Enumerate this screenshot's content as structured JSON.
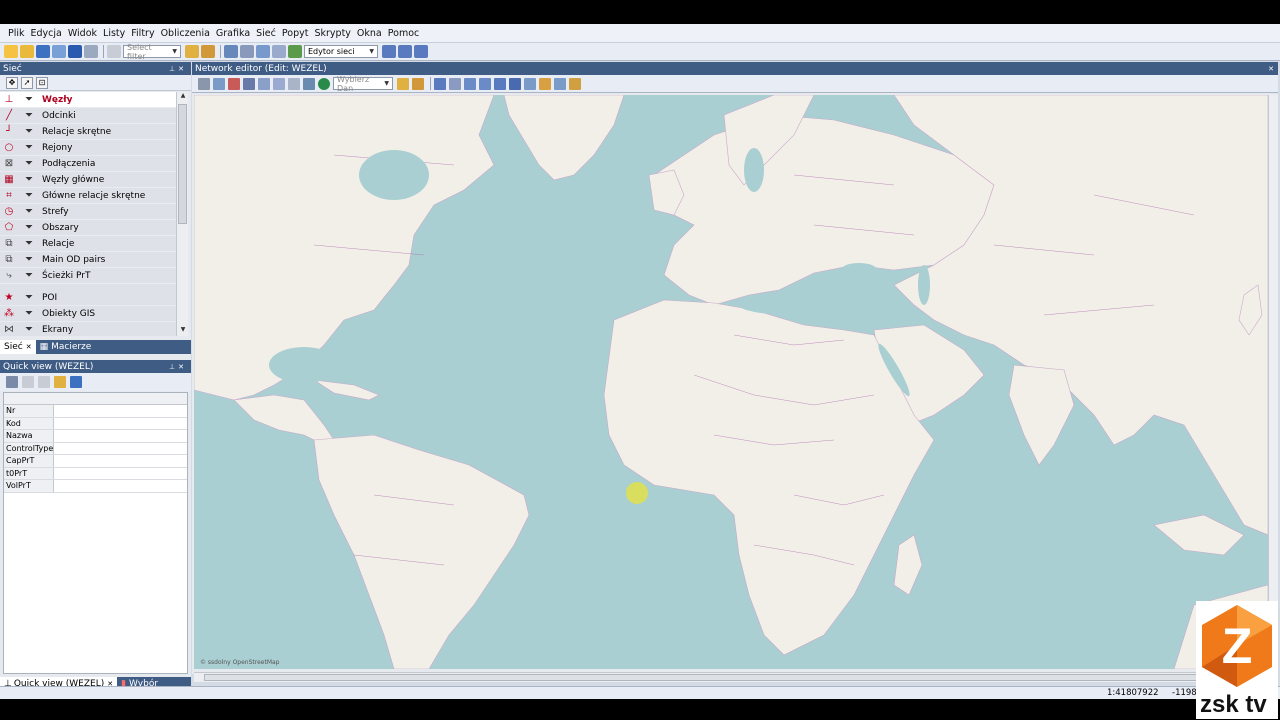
{
  "menu": [
    "Plik",
    "Edycja",
    "Widok",
    "Listy",
    "Filtry",
    "Obliczenia",
    "Grafika",
    "Sieć",
    "Popyt",
    "Skrypty",
    "Okna",
    "Pomoc"
  ],
  "toolbar": {
    "filter_placeholder": "Select filter",
    "mode_value": "Edytor sieci"
  },
  "siec_panel": {
    "title": "Sieć",
    "layers": [
      {
        "label": "Węzły",
        "icon": "node-icon",
        "active": true
      },
      {
        "label": "Odcinki",
        "icon": "link-icon"
      },
      {
        "label": "Relacje skrętne",
        "icon": "turn-icon"
      },
      {
        "label": "Rejony",
        "icon": "zone-icon"
      },
      {
        "label": "Podłączenia",
        "icon": "connector-icon"
      },
      {
        "label": "Węzły główne",
        "icon": "main-node-icon"
      },
      {
        "label": "Główne relacje skrętne",
        "icon": "main-turn-icon"
      },
      {
        "label": "Strefy",
        "icon": "territory-icon"
      },
      {
        "label": "Obszary",
        "icon": "area-icon"
      },
      {
        "label": "Relacje",
        "icon": "relation-icon"
      },
      {
        "label": "Main OD pairs",
        "icon": "od-pairs-icon"
      },
      {
        "label": "Ścieżki PrT",
        "icon": "path-icon"
      },
      {
        "label": "POI",
        "icon": "poi-star-icon"
      },
      {
        "label": "Obiekty GIS",
        "icon": "gis-icon"
      },
      {
        "label": "Ekrany",
        "icon": "screenline-icon"
      }
    ],
    "tabs": [
      "Sieć",
      "Macierze"
    ]
  },
  "quick_view": {
    "title": "Quick view (WEZEL)",
    "fields": [
      "Nr",
      "Kod",
      "Nazwa",
      "ControlType",
      "CapPrT",
      "t0PrT",
      "VolPrT"
    ],
    "tabs": [
      "Quick view (WEZEL)",
      "Wybór"
    ]
  },
  "map_panel": {
    "title": "Network editor (Edit: WEZEL)",
    "combo_placeholder": "Wybierz Dan",
    "attribution": "© ssdolny OpenStreetMap"
  },
  "status": {
    "scale": "1:41807922",
    "coord": "-1198"
  },
  "colors": {
    "panel_header": "#3f5c85",
    "ocean": "#aacfd2",
    "land": "#f2efe9",
    "border": "#b070b0",
    "active_layer": "#b0001e"
  },
  "watermark": {
    "label": "zsk tv"
  }
}
